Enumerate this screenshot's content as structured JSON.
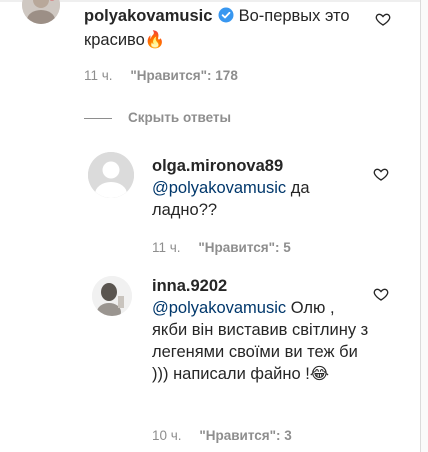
{
  "comments": [
    {
      "username": "polyakovamusic",
      "verified": true,
      "text": "Во-первых это красиво",
      "emoji": "🔥",
      "time": "11 ч.",
      "likes": "\"Нравится\": 178"
    }
  ],
  "hide_replies_label": "Скрыть ответы",
  "replies": [
    {
      "username": "olga.mironova89",
      "mention": "@polyakovamusic",
      "text": "да ладно??",
      "time": "11 ч.",
      "likes": "\"Нравится\": 5"
    },
    {
      "username": "inna.9202",
      "mention": "@polyakovamusic",
      "text": "Олю , якби він виставив світлину з легенями своїми ви теж би ))) написали файно !",
      "emoji": "😂",
      "time": "10 ч.",
      "likes": "\"Нравится\": 3"
    }
  ],
  "icons": {
    "heart": "heart-outline-icon",
    "verified": "verified-badge-icon",
    "avatar_placeholder": "default-avatar-icon"
  }
}
